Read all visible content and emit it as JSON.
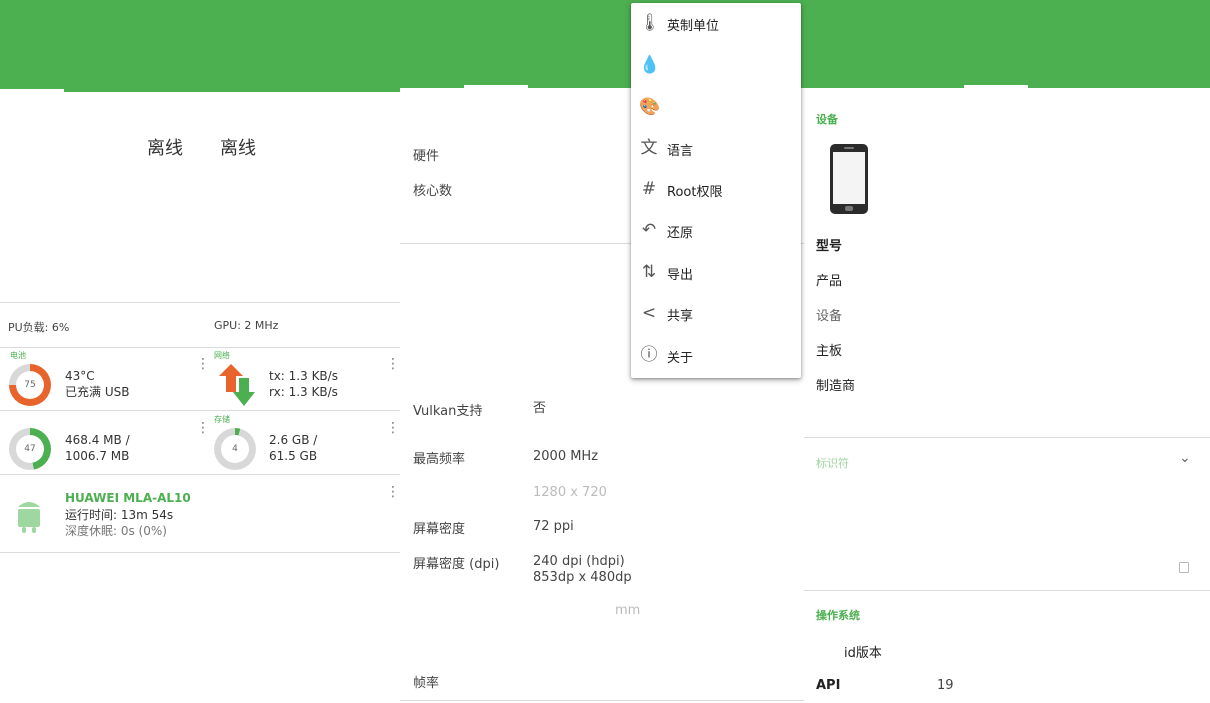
{
  "colors": {
    "accent": "#4caf50",
    "battery_ring": "#e8642c",
    "arrow_up": "#e8642c",
    "arrow_down": "#4caf50"
  },
  "panel1": {
    "offline_labels": [
      "离线",
      "离线"
    ],
    "cpu_load": "PU负载: 6%",
    "gpu": "GPU: 2 MHz",
    "battery": {
      "caption": "电池",
      "percent": 75,
      "ring_label": "75",
      "temp": "43°C",
      "status": "已充满 USB"
    },
    "network": {
      "caption": "网络",
      "tx": "tx: 1.3 KB/s",
      "rx": "rx: 1.3 KB/s"
    },
    "memory": {
      "percent": 47,
      "ring_label": "47",
      "used": "468.4 MB /",
      "total": "1006.7 MB"
    },
    "storage": {
      "caption": "存储",
      "percent": 4,
      "ring_label": "4",
      "used": "2.6 GB /",
      "total": "61.5 GB"
    },
    "device": {
      "name": "HUAWEI MLA-AL10",
      "uptime": "运行时间: 13m 54s",
      "deep_sleep": "深度休眠: 0s (0%)"
    }
  },
  "panel2": {
    "rows": [
      {
        "label": "硬件",
        "value": ""
      },
      {
        "label": "核心数",
        "value": ""
      },
      {
        "label": "Vulkan支持",
        "value": "否"
      },
      {
        "label": "最高频率",
        "value": "2000 MHz"
      },
      {
        "label": "",
        "value": "1280 x 720"
      },
      {
        "label": "屏幕密度",
        "value": "72 ppi"
      },
      {
        "label": "屏幕密度 (dpi)",
        "value": "240 dpi (hdpi)",
        "value2": "853dp x 480dp"
      },
      {
        "label": "",
        "value": "mm"
      },
      {
        "label": "帧率",
        "value": ""
      }
    ]
  },
  "menu": {
    "items": [
      {
        "icon": "thermometer-icon",
        "glyph": "🌡",
        "label": "英制单位"
      },
      {
        "icon": "water-drop-icon",
        "glyph": "💧",
        "label": ""
      },
      {
        "icon": "palette-icon",
        "glyph": "🎨",
        "label": ""
      },
      {
        "icon": "translate-icon",
        "glyph": "文",
        "label": "语言"
      },
      {
        "icon": "hash-icon",
        "glyph": "#",
        "label": "Root权限"
      },
      {
        "icon": "undo-icon",
        "glyph": "↶",
        "label": "还原"
      },
      {
        "icon": "swap-vert-icon",
        "glyph": "⇅",
        "label": "导出"
      },
      {
        "icon": "share-icon",
        "glyph": "<",
        "label": "共享"
      },
      {
        "icon": "info-icon",
        "glyph": "ⓘ",
        "label": "关于"
      }
    ]
  },
  "panel3": {
    "device_section": "设备",
    "device_labels": [
      "型号",
      "产品",
      "设备",
      "主板",
      "制造商"
    ],
    "identifiers_section": "标识符",
    "os_section": "操作系统",
    "os_rows": [
      {
        "label": "id版本",
        "value": ""
      },
      {
        "label": "API",
        "value": "19"
      }
    ]
  }
}
